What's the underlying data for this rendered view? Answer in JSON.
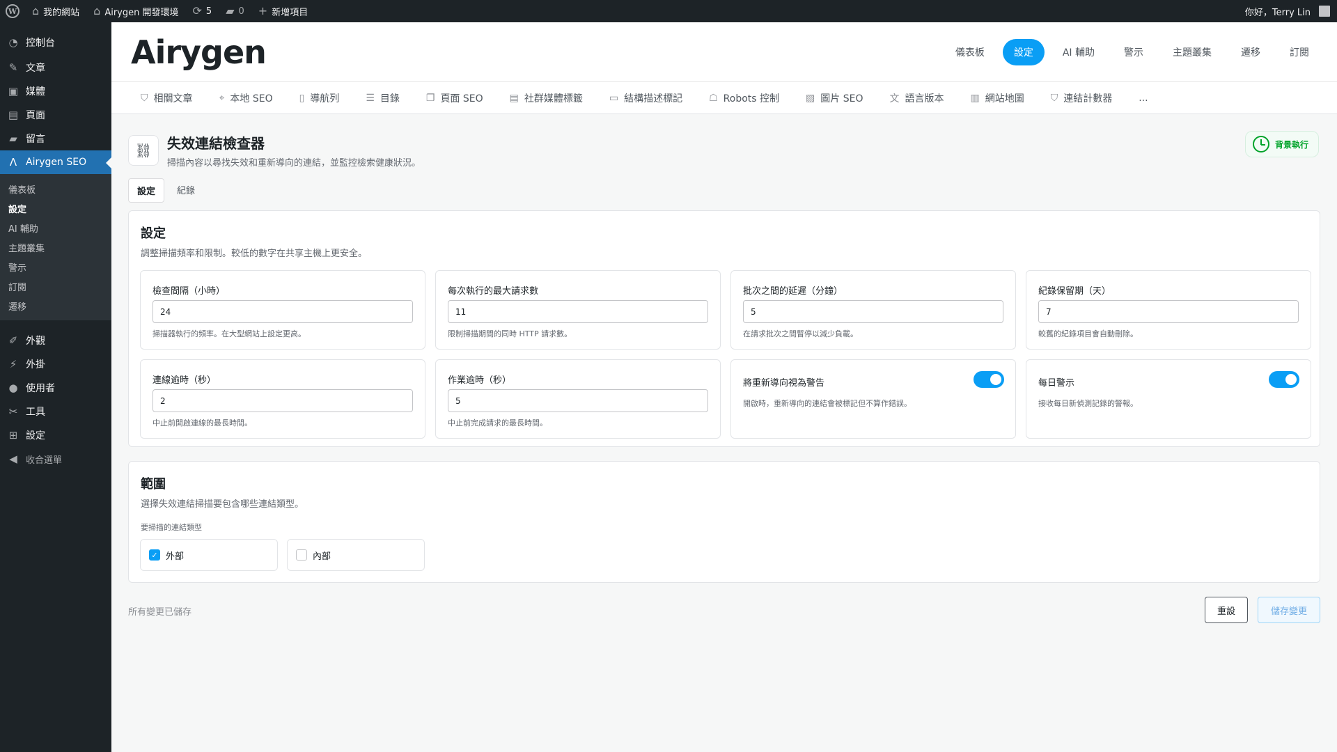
{
  "adminbar": {
    "site_name": "我的網站",
    "env_name": "Airygen 開發環境",
    "updates_count": "5",
    "comments_count": "0",
    "new_item": "新增項目",
    "greeting": "你好，Terry Lin"
  },
  "sidebar": {
    "top_items": [
      {
        "label": "控制台",
        "icon": "dashboard-icon"
      },
      {
        "label": "文章",
        "icon": "pin-icon"
      },
      {
        "label": "媒體",
        "icon": "media-icon"
      },
      {
        "label": "頁面",
        "icon": "page-icon"
      },
      {
        "label": "留言",
        "icon": "comment-icon"
      }
    ],
    "current_item": "Airygen SEO",
    "submenu": [
      "儀表板",
      "設定",
      "AI 輔助",
      "主題叢集",
      "警示",
      "訂閱",
      "遷移"
    ],
    "active_submenu": "設定",
    "bottom_items": [
      {
        "label": "外觀",
        "icon": "brush-icon"
      },
      {
        "label": "外掛",
        "icon": "plugin-icon"
      },
      {
        "label": "使用者",
        "icon": "user-icon"
      },
      {
        "label": "工具",
        "icon": "wrench-icon"
      },
      {
        "label": "設定",
        "icon": "settings-icon"
      }
    ],
    "collapse_label": "收合選單"
  },
  "header": {
    "logo": "Airygen",
    "nav": [
      "儀表板",
      "設定",
      "AI 輔助",
      "警示",
      "主題叢集",
      "遷移",
      "訂閱"
    ],
    "active_nav": "設定"
  },
  "subnav": {
    "items": [
      {
        "label": "相關文章",
        "icon": "shield-icon"
      },
      {
        "label": "本地 SEO",
        "icon": "location-pin-icon"
      },
      {
        "label": "導航列",
        "icon": "document-icon"
      },
      {
        "label": "目錄",
        "icon": "list-icon"
      },
      {
        "label": "頁面 SEO",
        "icon": "pages-icon"
      },
      {
        "label": "社群媒體標籤",
        "icon": "card-icon"
      },
      {
        "label": "結構描述標記",
        "icon": "message-icon"
      },
      {
        "label": "Robots 控制",
        "icon": "robot-icon"
      },
      {
        "label": "圖片 SEO",
        "icon": "image-icon"
      },
      {
        "label": "語言版本",
        "icon": "translate-icon"
      },
      {
        "label": "網站地圖",
        "icon": "map-icon"
      },
      {
        "label": "連結計數器",
        "icon": "shield-check-icon"
      }
    ],
    "more": "..."
  },
  "page": {
    "title": "失效連結檢查器",
    "description": "掃描內容以尋找失效和重新導向的連結，並監控檢索健康狀況。",
    "badge": "背景執行",
    "tabs": [
      "設定",
      "紀錄"
    ],
    "active_tab": "設定"
  },
  "settings_panel": {
    "title": "設定",
    "description": "調整掃描頻率和限制。較低的數字在共享主機上更安全。",
    "fields": [
      {
        "label": "檢查間隔（小時）",
        "value": "24",
        "hint": "掃描器執行的頻率。在大型網站上設定更高。"
      },
      {
        "label": "每次執行的最大請求數",
        "value": "11",
        "hint": "限制掃描期間的同時 HTTP 請求數。"
      },
      {
        "label": "批次之間的延遲（分鐘）",
        "value": "5",
        "hint": "在請求批次之間暫停以減少負載。"
      },
      {
        "label": "紀錄保留期（天）",
        "value": "7",
        "hint": "較舊的紀錄項目會自動刪除。"
      },
      {
        "label": "連線逾時（秒）",
        "value": "2",
        "hint": "中止前開啟連線的最長時間。"
      },
      {
        "label": "作業逾時（秒）",
        "value": "5",
        "hint": "中止前完成請求的最長時間。"
      }
    ],
    "toggles": [
      {
        "label": "將重新導向視為警告",
        "hint": "開啟時，重新導向的連結會被標記但不算作錯誤。",
        "on": true
      },
      {
        "label": "每日警示",
        "hint": "接收每日新偵測記錄的警報。",
        "on": true
      }
    ]
  },
  "scope_panel": {
    "title": "範圍",
    "description": "選擇失效連結掃描要包含哪些連結類型。",
    "sublabel": "要掃描的連結類型",
    "options": [
      {
        "label": "外部",
        "checked": true
      },
      {
        "label": "內部",
        "checked": false
      }
    ]
  },
  "footer": {
    "status": "所有變更已儲存",
    "reset_label": "重設",
    "save_label": "儲存變更"
  },
  "colors": {
    "accent": "#0a9ef5",
    "wp_blue": "#2271b1",
    "sidebar_bg": "#1d2327",
    "success": "#00a32a"
  }
}
